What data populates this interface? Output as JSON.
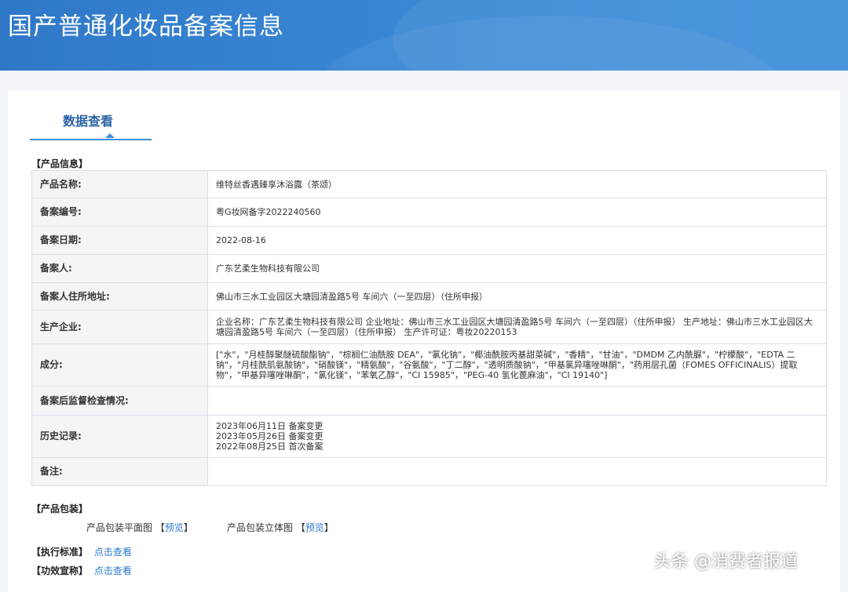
{
  "header": {
    "title": "国产普通化妆品备案信息"
  },
  "tabs": [
    {
      "label": "数据查看"
    }
  ],
  "product_info": {
    "section_label": "【产品信息】",
    "rows": [
      {
        "key": "产品名称:",
        "value": "维特丝香遇臻享沐浴露（茶颂）"
      },
      {
        "key": "备案编号:",
        "value": "粤G妆网备字2022240560"
      },
      {
        "key": "备案日期:",
        "value": "2022-08-16"
      },
      {
        "key": "备案人:",
        "value": "广东艺柔生物科技有限公司"
      },
      {
        "key": "备案人住所地址:",
        "value": "佛山市三水工业园区大塘园清盈路5号 车间六（一至四层）（住所申报）"
      },
      {
        "key": "生产企业:",
        "value": "企业名称：广东艺柔生物科技有限公司 企业地址：佛山市三水工业园区大塘园清盈路5号 车间六（一至四层）（住所申报） 生产地址：佛山市三水工业园区大塘园清盈路5号 车间六（一至四层）（住所申报） 生产许可证：粤妆20220153"
      },
      {
        "key": "成分:",
        "value": "[\"水\"，\"月桂醇聚醚硫酸酯钠\"，\"棕榈仁油酰胺 DEA\"，\"氯化钠\"，\"椰油酰胺丙基甜菜碱\"，\"香精\"，\"甘油\"，\"DMDM 乙内酰脲\"，\"柠檬酸\"，\"EDTA 二钠\"，\"月桂酰肌氨酸钠\"，\"硝酸镁\"，\"精氨酸\"，\"谷氨酸\"，\"丁二醇\"，\"透明质酸钠\"，\"甲基氯异噻唑啉酮\"，\"药用层孔菌（FOMES OFFICINALIS）提取物\"，\"甲基异噻唑啉酮\"，\"氯化镁\"，\"苯氧乙醇\"，\"CI 15985\"，\"PEG-40 氢化蓖麻油\"，\"CI 19140\"]"
      },
      {
        "key": "备案后监督检查情况:",
        "value": ""
      },
      {
        "key": "历史记录:",
        "history": [
          "2023年06月11日 备案变更",
          "2023年05月26日 备案变更",
          "2022年08月25日 首次备案"
        ]
      },
      {
        "key": "备注:",
        "value": ""
      }
    ]
  },
  "packaging": {
    "section_label": "【产品包装】",
    "flat_label": "产品包装平面图",
    "solid_label": "产品包装立体图",
    "preview_link": "预览",
    "bracket_open": "【",
    "bracket_close": "】"
  },
  "standard": {
    "label": "【执行标准】",
    "link": "点击查看"
  },
  "claims": {
    "label": "【功效宣称】",
    "link": "点击查看"
  },
  "watermark": "头条 @消费者报道",
  "colors": {
    "banner": "#3b8ad6",
    "link": "#2a7bd1",
    "tab_active": "#2a63a8"
  }
}
